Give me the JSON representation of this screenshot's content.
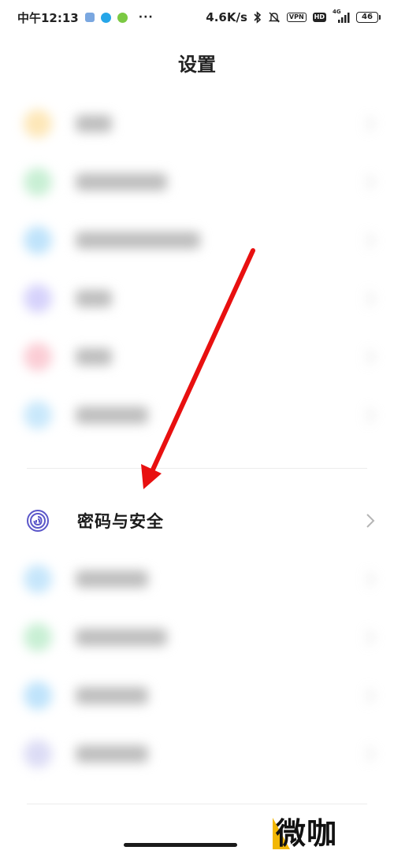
{
  "status_bar": {
    "time": "中午12:13",
    "more": "···",
    "network_speed": "4.6K/s",
    "vpn": "VPN",
    "hd": "HD",
    "signal_type": "4G",
    "battery": "46",
    "icons": [
      "bluetooth-icon",
      "mute-icon",
      "vpn-icon",
      "hd-icon",
      "signal-icon",
      "battery-icon"
    ]
  },
  "header": {
    "title": "设置"
  },
  "settings": {
    "blurred_top_rows": [
      {
        "icon": "blurred-icon",
        "color": "#fde7b8"
      },
      {
        "icon": "blurred-icon",
        "color": "#c8efd4"
      },
      {
        "icon": "blurred-icon",
        "color": "#bfe3fb"
      },
      {
        "icon": "blurred-icon",
        "color": "#d6d2fb"
      },
      {
        "icon": "blurred-icon",
        "color": "#fbcdd5"
      },
      {
        "icon": "blurred-icon",
        "color": "#c9e8fb"
      }
    ],
    "focus_item": {
      "label": "密码与安全",
      "icon": "fingerprint-icon",
      "icon_color": "#5b57c9"
    },
    "blurred_bottom_rows": [
      {
        "icon": "blurred-icon",
        "color": "#c6e6fb"
      },
      {
        "icon": "blurred-icon",
        "color": "#c8efd4"
      },
      {
        "icon": "blurred-icon",
        "color": "#bfe3fb"
      },
      {
        "icon": "blurred-icon",
        "color": "#dcdcf5"
      }
    ]
  },
  "annotation": {
    "arrow_color": "#e81010"
  },
  "watermark": {
    "text": "微咖",
    "accent_color": "#f2b705"
  }
}
